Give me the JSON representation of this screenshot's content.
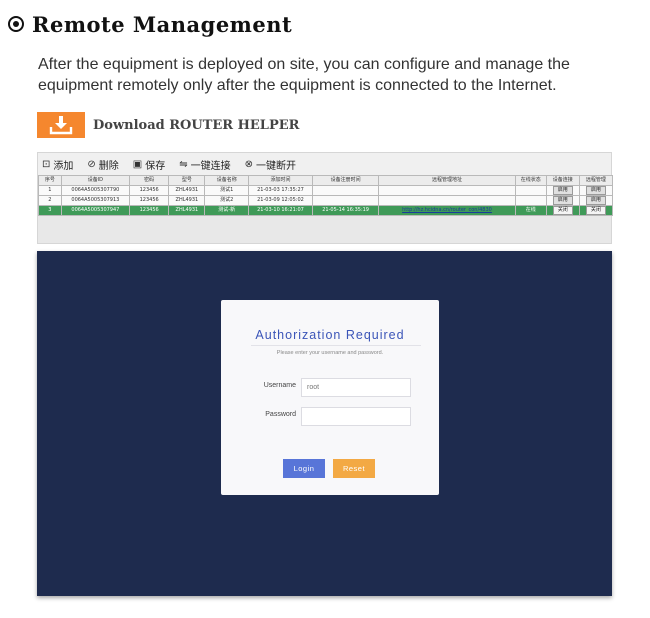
{
  "section": {
    "title": "Remote Management",
    "intro": "After the equipment is deployed on site, you can configure and manage the equipment remotely only after the equipment is connected to the Internet."
  },
  "download": {
    "label": "Download ROUTER HELPER",
    "icon": "download-icon",
    "color": "#f5872e"
  },
  "device_manager": {
    "toolbar": [
      {
        "icon": "add-icon",
        "glyph": "⊡",
        "label": "添加"
      },
      {
        "icon": "delete-icon",
        "glyph": "⊘",
        "label": "删除"
      },
      {
        "icon": "save-icon",
        "glyph": "▣",
        "label": "保存"
      },
      {
        "icon": "connect-icon",
        "glyph": "⇋",
        "label": "一键连接"
      },
      {
        "icon": "disconnect-icon",
        "glyph": "⊗",
        "label": "一键断开"
      }
    ],
    "columns": [
      "序号",
      "设备ID",
      "密码",
      "型号",
      "设备名称",
      "添加时间",
      "设备注册时间",
      "远程管理地址",
      "在线状态",
      "设备连接",
      "远程管理"
    ],
    "rows": [
      [
        "1",
        "0064A5005307790",
        "123456",
        "ZHL4931",
        "测试1",
        "21-03-03 17:35:27",
        "",
        "",
        "",
        "启用",
        "启用"
      ],
      [
        "2",
        "0064A5005307913",
        "123456",
        "ZHL4931",
        "测试2",
        "21-03-09 12:05:02",
        "",
        "",
        "",
        "启用",
        "启用"
      ],
      [
        "3",
        "0064A5005307947",
        "123456",
        "ZHL4931",
        "测试-新",
        "21-03-10 16:21:07",
        "21-05-14 16:35:19",
        "http://hz.hcidna.cn/router_con/4830",
        "在线",
        "关闭",
        "关闭"
      ]
    ],
    "active_row_color": "#3f9a58"
  },
  "login": {
    "title": "Authorization Required",
    "subtitle": "Please enter your username and password.",
    "username_label": "Username",
    "username_value": "root",
    "password_label": "Password",
    "password_value": "",
    "login_button": "Login",
    "reset_button": "Reset",
    "background_color": "#1e2b4e",
    "login_color": "#5875d8",
    "reset_color": "#f3a944"
  }
}
